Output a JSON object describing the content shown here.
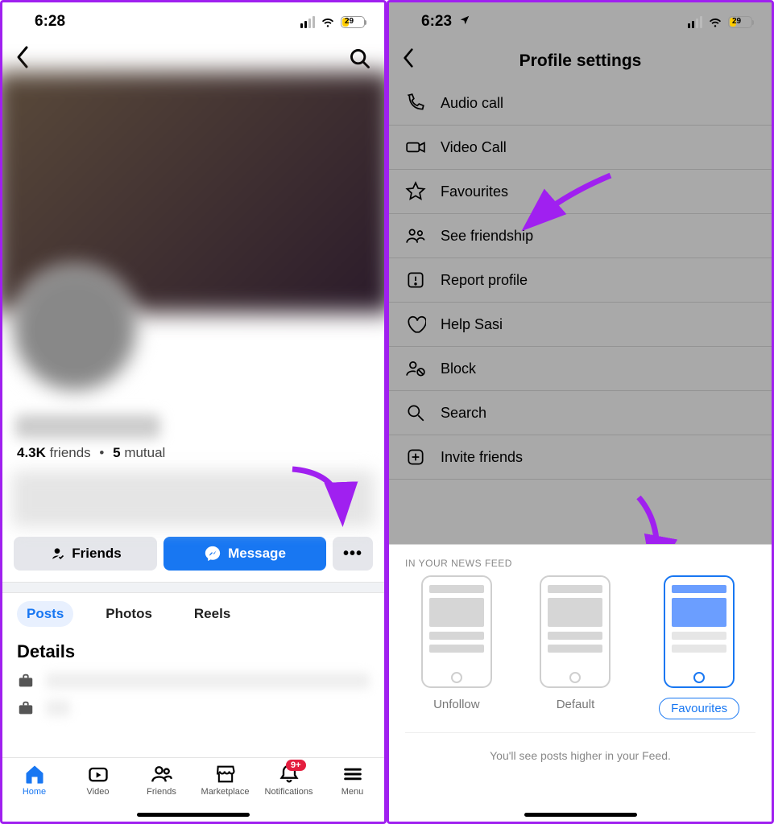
{
  "left": {
    "status": {
      "time": "6:28",
      "battery": "29"
    },
    "stats": {
      "friends_count": "4.3K",
      "friends_label": "friends",
      "mutual_count": "5",
      "mutual_label": "mutual"
    },
    "actions": {
      "friends": "Friends",
      "message": "Message",
      "more": "•••"
    },
    "tabs": {
      "posts": "Posts",
      "photos": "Photos",
      "reels": "Reels"
    },
    "details_title": "Details",
    "tabbar": {
      "home": "Home",
      "video": "Video",
      "friends": "Friends",
      "marketplace": "Marketplace",
      "notifications": "Notifications",
      "menu": "Menu",
      "badge": "9+"
    }
  },
  "right": {
    "status": {
      "time": "6:23",
      "battery": "29"
    },
    "title": "Profile settings",
    "items": {
      "audio": "Audio call",
      "video": "Video Call",
      "fav": "Favourites",
      "friendship": "See friendship",
      "report": "Report profile",
      "help": "Help Sasi",
      "block": "Block",
      "search": "Search",
      "invite": "Invite friends"
    },
    "sheet": {
      "heading": "IN YOUR NEWS FEED",
      "unfollow": "Unfollow",
      "default": "Default",
      "favourites": "Favourites",
      "footer": "You'll see posts higher in your Feed."
    }
  }
}
